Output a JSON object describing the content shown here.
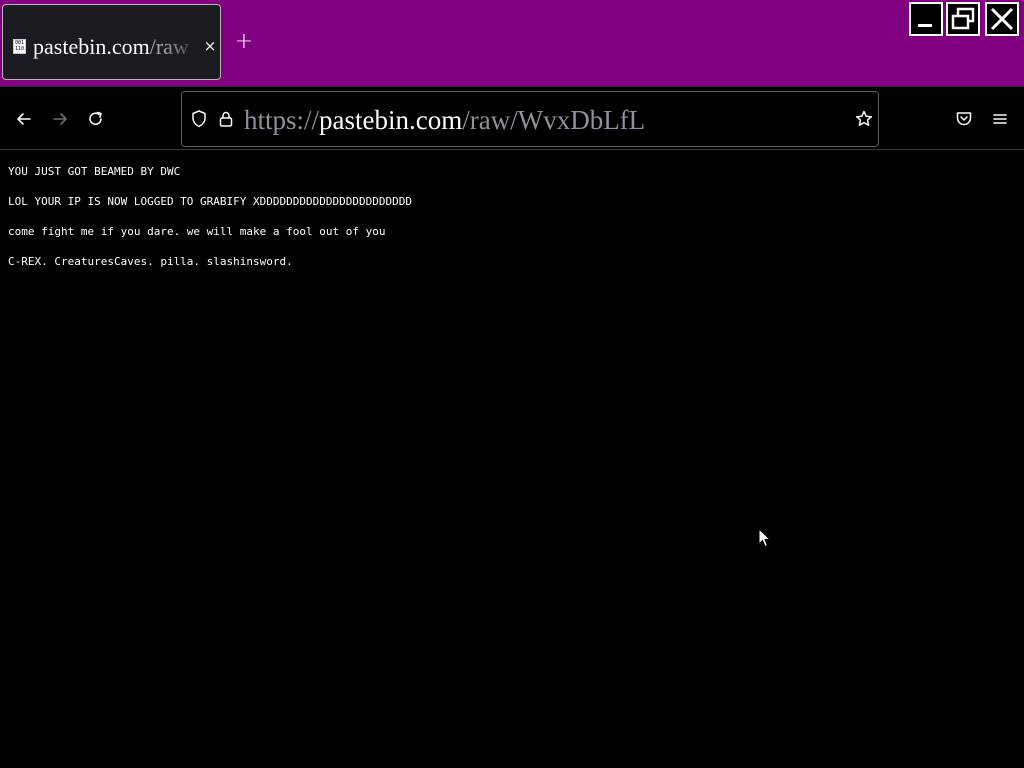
{
  "browser": {
    "tab": {
      "favicon_text": "001\n110",
      "title_host": "pastebin.com",
      "title_rest": "/raw",
      "close_glyph": "×"
    },
    "new_tab_glyph": "+",
    "url": {
      "scheme": "https://",
      "host": "pastebin.com",
      "path": "/raw/WvxDbLfL"
    },
    "icons": [
      "back-arrow-icon",
      "forward-arrow-icon",
      "reload-icon",
      "shield-icon",
      "lock-icon",
      "bookmark-star-icon",
      "pocket-icon",
      "hamburger-menu-icon",
      "minimize-icon",
      "restore-icon",
      "close-icon"
    ],
    "accent_color": "#800080"
  },
  "page": {
    "lines": [
      "YOU JUST GOT BEAMED BY DWC",
      "LOL YOUR IP IS NOW LOGGED TO GRABIFY XDDDDDDDDDDDDDDDDDDDDDDD",
      "come fight me if you dare. we will make a fool out of you",
      "C-REX. CreaturesCaves. pilla. slashinsword."
    ]
  }
}
